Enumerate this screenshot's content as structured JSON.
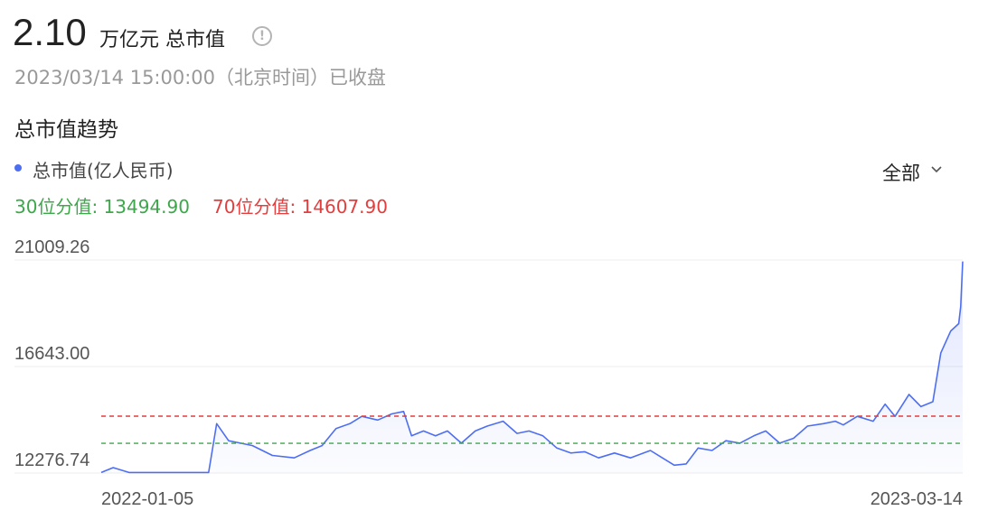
{
  "header": {
    "value": "2.10",
    "unit": "万亿元 总市值",
    "info_icon": "info-circle-icon",
    "timestamp": "2023/03/14 15:00:00（北京时间）已收盘"
  },
  "section_title": "总市值趋势",
  "legend": {
    "label": "总市值(亿人民币)",
    "color": "#4e6ef2"
  },
  "range_selector": {
    "value": "全部",
    "icon": "chevron-down-icon"
  },
  "percentiles": {
    "p30_label": "30位分值: 13494.90",
    "p70_label": "70位分值: 14607.90",
    "p30_color": "#3ca84a",
    "p70_color": "#e33d3d"
  },
  "chart_data": {
    "type": "area",
    "y_ticks": [
      "21009.26",
      "16643.00",
      "12276.74"
    ],
    "ylim": [
      12276.74,
      21009.26
    ],
    "x_ticks": [
      "2022-01-05",
      "2023-03-14"
    ],
    "xlim": [
      "2022-01-05",
      "2023-03-14"
    ],
    "reference_lines": [
      {
        "name": "30位分值",
        "value": 13494.9,
        "color": "#3ca84a",
        "style": "dashed"
      },
      {
        "name": "70位分值",
        "value": 14607.9,
        "color": "#e33d3d",
        "style": "dashed"
      }
    ],
    "series": [
      {
        "color": "#4e6ef2",
        "points": [
          [
            "2022-01-05",
            12300
          ],
          [
            "2022-01-11",
            12500
          ],
          [
            "2022-01-19",
            12300
          ],
          [
            "2022-02-28",
            12300
          ],
          [
            "2022-03-04",
            14300
          ],
          [
            "2022-03-10",
            13600
          ],
          [
            "2022-03-16",
            13500
          ],
          [
            "2022-03-22",
            13400
          ],
          [
            "2022-04-01",
            13000
          ],
          [
            "2022-04-12",
            12900
          ],
          [
            "2022-04-20",
            13200
          ],
          [
            "2022-04-26",
            13400
          ],
          [
            "2022-05-03",
            14100
          ],
          [
            "2022-05-10",
            14300
          ],
          [
            "2022-05-16",
            14600
          ],
          [
            "2022-05-24",
            14450
          ],
          [
            "2022-05-31",
            14700
          ],
          [
            "2022-06-06",
            14800
          ],
          [
            "2022-06-10",
            13800
          ],
          [
            "2022-06-16",
            14000
          ],
          [
            "2022-06-22",
            13800
          ],
          [
            "2022-06-28",
            14000
          ],
          [
            "2022-07-05",
            13500
          ],
          [
            "2022-07-12",
            14000
          ],
          [
            "2022-07-18",
            14200
          ],
          [
            "2022-07-26",
            14400
          ],
          [
            "2022-08-02",
            13900
          ],
          [
            "2022-08-08",
            14000
          ],
          [
            "2022-08-15",
            13800
          ],
          [
            "2022-08-22",
            13300
          ],
          [
            "2022-08-29",
            13100
          ],
          [
            "2022-09-05",
            13150
          ],
          [
            "2022-09-12",
            12900
          ],
          [
            "2022-09-20",
            13100
          ],
          [
            "2022-09-28",
            12900
          ],
          [
            "2022-10-08",
            13200
          ],
          [
            "2022-10-13",
            12950
          ],
          [
            "2022-10-20",
            12600
          ],
          [
            "2022-10-26",
            12650
          ],
          [
            "2022-11-01",
            13300
          ],
          [
            "2022-11-08",
            13200
          ],
          [
            "2022-11-15",
            13600
          ],
          [
            "2022-11-22",
            13500
          ],
          [
            "2022-11-29",
            13800
          ],
          [
            "2022-12-05",
            14000
          ],
          [
            "2022-12-12",
            13500
          ],
          [
            "2022-12-19",
            13700
          ],
          [
            "2022-12-26",
            14200
          ],
          [
            "2023-01-03",
            14300
          ],
          [
            "2023-01-09",
            14400
          ],
          [
            "2023-01-13",
            14250
          ],
          [
            "2023-01-20",
            14600
          ],
          [
            "2023-01-28",
            14400
          ],
          [
            "2023-02-03",
            15100
          ],
          [
            "2023-02-08",
            14600
          ],
          [
            "2023-02-15",
            15500
          ],
          [
            "2023-02-21",
            15000
          ],
          [
            "2023-02-27",
            15200
          ],
          [
            "2023-03-03",
            17200
          ],
          [
            "2023-03-08",
            18100
          ],
          [
            "2023-03-12",
            18400
          ],
          [
            "2023-03-13",
            19100
          ],
          [
            "2023-03-14",
            20950
          ]
        ]
      }
    ],
    "grid": true
  }
}
